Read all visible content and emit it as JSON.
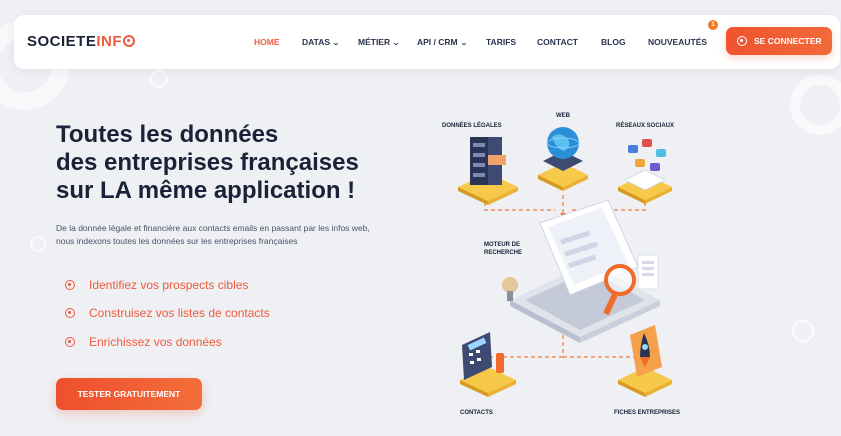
{
  "header": {
    "logo": {
      "part1": "SOCIETE",
      "part2": "INF"
    },
    "nav": [
      {
        "label": "HOME",
        "active": true,
        "has_caret": false
      },
      {
        "label": "DATAS",
        "active": false,
        "has_caret": true
      },
      {
        "label": "MÉTIER",
        "active": false,
        "has_caret": true
      },
      {
        "label": "API / CRM",
        "active": false,
        "has_caret": true
      },
      {
        "label": "TARIFS",
        "active": false,
        "has_caret": false
      },
      {
        "label": "CONTACT",
        "active": false,
        "has_caret": false
      },
      {
        "label": "BLOG",
        "active": false,
        "has_caret": false
      },
      {
        "label": "NOUVEAUTÉS",
        "active": false,
        "has_caret": false
      }
    ],
    "notification_count": "1",
    "connect_label": "SE CONNECTER"
  },
  "hero": {
    "title_lines": [
      "Toutes les données",
      "des entreprises françaises",
      "sur LA même application !"
    ],
    "description": "De la donnée légale et financière aux contacts emails en passant par les infos web, nous indexons toutes les données sur les entreprises françaises",
    "bullets": [
      "Identifiez vos prospects cibles",
      "Construisez vos listes de contacts",
      "Enrichissez vos données"
    ],
    "cta_label": "TESTER GRATUITEMENT"
  },
  "illustration": {
    "labels": {
      "legal": "DONNÉES LÉGALES",
      "web": "WEB",
      "social": "RÉSEAUX SOCIAUX",
      "engine_line1": "MOTEUR DE",
      "engine_line2": "RECHERCHE",
      "contacts": "CONTACTS",
      "companies": "FICHES ENTREPRISES"
    }
  },
  "colors": {
    "accent": "#ef5a3c",
    "text_dark": "#1a2238",
    "background": "#eef0f4",
    "badge": "#f07a24"
  },
  "icons": [
    "target-icon",
    "chevron-down-icon",
    "server-icon",
    "globe-icon",
    "social-icon",
    "laptop-icon",
    "magnifier-icon",
    "calculator-icon",
    "rocket-icon"
  ]
}
